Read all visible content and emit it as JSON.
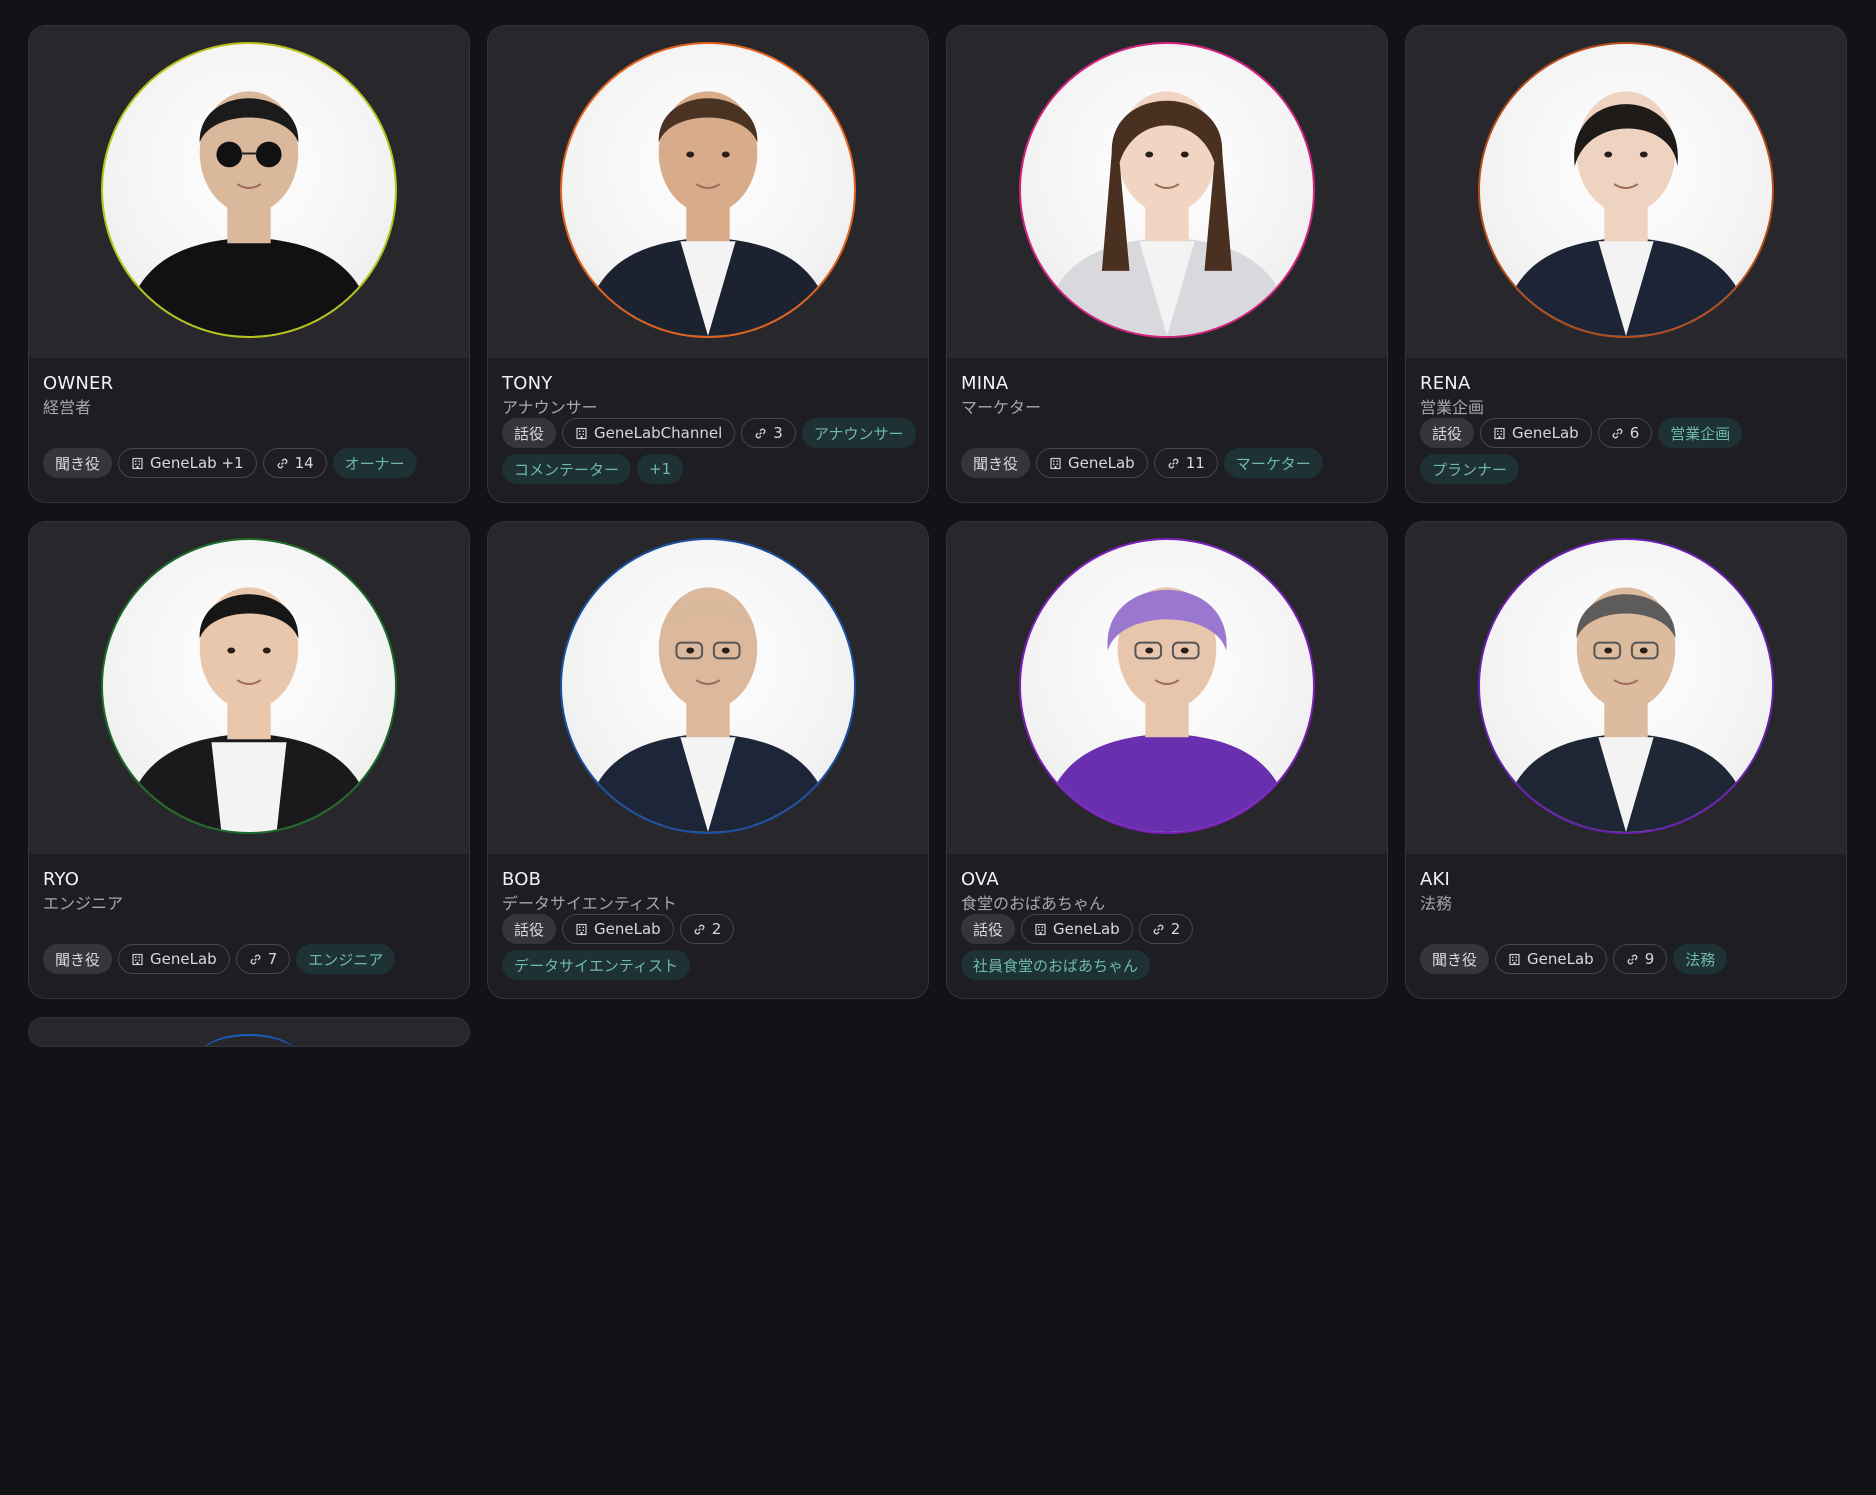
{
  "cards": [
    {
      "name": "OWNER",
      "role": "経営者",
      "mode": "聞き役",
      "org": "GeneLab +1",
      "links": "14",
      "tags": [
        "オーナー"
      ],
      "ring": "#b7c21a",
      "bg": "#ffffff",
      "shirt": "#111111",
      "hair": "#1b1b1b",
      "skin": "#d9b89c",
      "accessory": "sunglasses"
    },
    {
      "name": "TONY",
      "role": "アナウンサー",
      "mode": "話役",
      "org": "GeneLabChannel",
      "links": "3",
      "tags": [
        "アナウンサー",
        "コメンテーター",
        "+1"
      ],
      "ring": "#e0621c",
      "bg": "#ffffff",
      "shirt": "#1c2230",
      "hair": "#4a3322",
      "skin": "#d8ab8b",
      "accessory": "none"
    },
    {
      "name": "MINA",
      "role": "マーケター",
      "mode": "聞き役",
      "org": "GeneLab",
      "links": "11",
      "tags": [
        "マーケター"
      ],
      "ring": "#d1247f",
      "bg": "#ffffff",
      "shirt": "#d9d9dd",
      "hair": "#4a3020",
      "skin": "#f1d4c2",
      "accessory": "none"
    },
    {
      "name": "RENA",
      "role": "営業企画",
      "mode": "話役",
      "org": "GeneLab",
      "links": "6",
      "tags": [
        "営業企画",
        "プランナー"
      ],
      "ring": "#b34d1c",
      "bg": "#ffffff",
      "shirt": "#1d2436",
      "hair": "#1e1a18",
      "skin": "#efd3c1",
      "accessory": "none"
    },
    {
      "name": "RYO",
      "role": "エンジニア",
      "mode": "聞き役",
      "org": "GeneLab",
      "links": "7",
      "tags": [
        "エンジニア"
      ],
      "ring": "#1e6a2a",
      "bg": "#ffffff",
      "shirt": "#1a1a1c",
      "hair": "#161616",
      "skin": "#e8c7ad",
      "accessory": "none"
    },
    {
      "name": "BOB",
      "role": "データサイエンティスト",
      "mode": "話役",
      "org": "GeneLab",
      "links": "2",
      "tags": [
        "データサイエンティスト"
      ],
      "ring": "#1b4fa0",
      "bg": "#ffffff",
      "shirt": "#1d2538",
      "hair": "#d9b79c",
      "skin": "#dcb89c",
      "accessory": "glasses"
    },
    {
      "name": "OVA",
      "role": "食堂のおばあちゃん",
      "mode": "話役",
      "org": "GeneLab",
      "links": "2",
      "tags": [
        "社員食堂のおばあちゃん"
      ],
      "ring": "#7a1fb8",
      "bg": "#ffffff",
      "shirt": "#6a2fae",
      "hair": "#9a78cf",
      "skin": "#e8c6ad",
      "accessory": "glasses"
    },
    {
      "name": "AKI",
      "role": "法務",
      "mode": "聞き役",
      "org": "GeneLab",
      "links": "9",
      "tags": [
        "法務"
      ],
      "ring": "#6a1fb0",
      "bg": "#ffffff",
      "shirt": "#1f2636",
      "hair": "#5e5c5a",
      "skin": "#ddbb9f",
      "accessory": "glasses"
    }
  ],
  "partial_card": {
    "ring": "#1b5fc0"
  }
}
